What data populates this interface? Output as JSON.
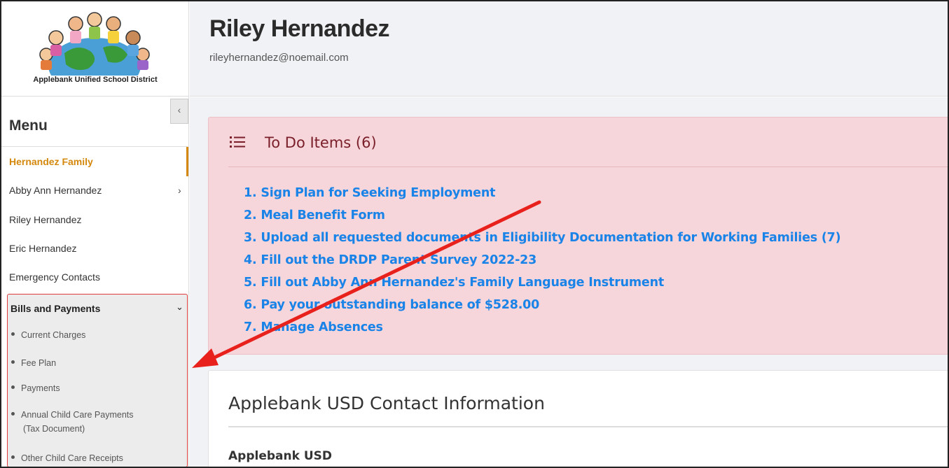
{
  "logo": {
    "caption": "Applebank Unified School District"
  },
  "sidebar": {
    "collapse_glyph": "‹",
    "menu_title": "Menu",
    "items": [
      {
        "label": "Hernandez Family",
        "active": true
      },
      {
        "label": "Abby Ann Hernandez",
        "has_submenu": true
      },
      {
        "label": "Riley Hernandez"
      },
      {
        "label": "Eric Hernandez"
      },
      {
        "label": "Emergency Contacts"
      }
    ],
    "bills": {
      "label": "Bills and Payments",
      "expanded": true,
      "subitems": [
        {
          "label": "Current Charges"
        },
        {
          "label": "Fee Plan"
        },
        {
          "label": "Payments"
        },
        {
          "label": "Annual Child Care Payments",
          "label2": "(Tax Document)"
        },
        {
          "label": "Other Child Care Receipts"
        }
      ]
    }
  },
  "header": {
    "name": "Riley Hernandez",
    "email": "rileyhernandez@noemail.com"
  },
  "todo": {
    "title": "To Do Items (6)",
    "items": [
      "1. Sign Plan for Seeking Employment",
      "2. Meal Benefit Form",
      "3. Upload all requested documents in Eligibility Documentation for Working Families (7)",
      "4. Fill out the DRDP Parent Survey 2022-23",
      "5. Fill out Abby Ann Hernandez's Family Language Instrument",
      "6. Pay your outstanding balance of $528.00",
      "7. Manage Absences"
    ]
  },
  "contact": {
    "title": "Applebank USD Contact Information",
    "org": "Applebank USD"
  },
  "colors": {
    "accent": "#d4880d",
    "link": "#1a83e8",
    "todo_bg": "#f6d6da",
    "annotation": "#e8211c"
  }
}
